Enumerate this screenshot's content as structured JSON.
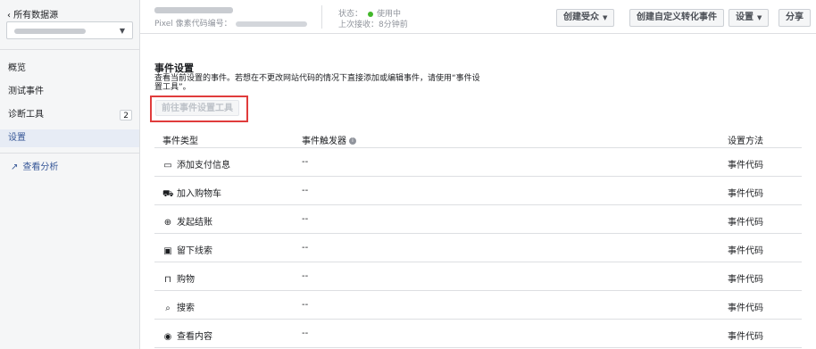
{
  "sidebar": {
    "back_label": "‹ 所有数据源",
    "items": [
      {
        "label": "概览"
      },
      {
        "label": "测试事件"
      },
      {
        "label": "诊断工具",
        "badge": "2"
      },
      {
        "label": "设置"
      }
    ],
    "analytics_label": "查看分析"
  },
  "topbar": {
    "pixel_id_label": "Pixel 像素代码编号：",
    "status_label": "状态：",
    "status_value": "使用中",
    "last_received": "上次接收：8分钟前",
    "buttons": {
      "create_audience": "创建受众",
      "create_conversion": "创建自定义转化事件",
      "settings": "设置",
      "share": "分享"
    }
  },
  "main": {
    "title": "事件设置",
    "description": "查看当前设置的事件。若想在不更改网站代码的情况下直接添加或编辑事件，请使用“事件设置工具”。",
    "goto_button": "前往事件设置工具",
    "table": {
      "headers": {
        "type": "事件类型",
        "trigger": "事件触发器",
        "method": "设置方法"
      },
      "rows": [
        {
          "icon": "credit-card-icon",
          "name": "添加支付信息",
          "trigger": "--",
          "method": "事件代码"
        },
        {
          "icon": "cart-icon",
          "name": "加入购物车",
          "trigger": "--",
          "method": "事件代码"
        },
        {
          "icon": "basket-icon",
          "name": "发起结账",
          "trigger": "--",
          "method": "事件代码"
        },
        {
          "icon": "contact-card-icon",
          "name": "留下线索",
          "trigger": "--",
          "method": "事件代码"
        },
        {
          "icon": "shopping-bag-icon",
          "name": "购物",
          "trigger": "--",
          "method": "事件代码"
        },
        {
          "icon": "search-icon",
          "name": "搜索",
          "trigger": "--",
          "method": "事件代码"
        },
        {
          "icon": "eye-icon",
          "name": "查看内容",
          "trigger": "--",
          "method": "事件代码"
        }
      ]
    }
  },
  "colors": {
    "highlight_box": "#e03c3c",
    "status_dot": "#42b72a",
    "link": "#385898"
  }
}
